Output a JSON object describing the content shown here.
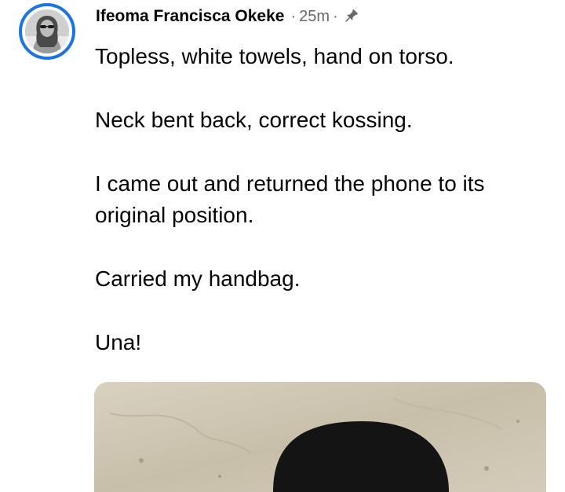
{
  "post": {
    "author": "Ifeoma Francisca Okeke",
    "separator": "·",
    "time": "25m",
    "separator2": "·",
    "privacy_icon": "pin-icon",
    "paragraphs": [
      "Topless, white towels, hand on torso.",
      "Neck bent back, correct kossing.",
      "I came out and returned the phone to its original position.",
      "Carried my handbag.",
      "Una!"
    ]
  },
  "colors": {
    "avatar_ring": "#1b74e4",
    "meta_text": "#65676b",
    "body_text": "#050505"
  }
}
